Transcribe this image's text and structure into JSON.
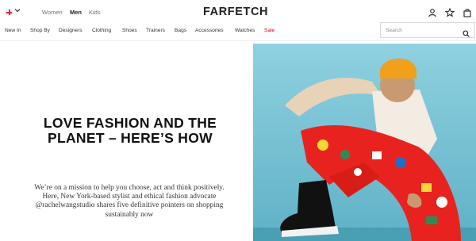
{
  "header": {
    "flag_icon": "denmark-flag-icon",
    "chevron_icon": "chevron-down-icon",
    "departments": [
      "Women",
      "Men",
      "Kids"
    ],
    "active_department": "Men",
    "logo": "FARFETCH",
    "icons": [
      "user-icon",
      "star-icon",
      "bag-icon"
    ]
  },
  "nav": {
    "items": [
      "New In",
      "Shop By",
      "Designers",
      "Clothing",
      "Shoes",
      "Trainers",
      "Bags",
      "Accessories",
      "Watches"
    ],
    "sale_label": "Sale",
    "sale_color": "#d0021b"
  },
  "search": {
    "placeholder": "Search",
    "icon": "search-icon"
  },
  "main": {
    "headline": "LOVE FASHION AND THE PLANET – HERE’S HOW",
    "body": "We’re on a mission to help you choose, act and think positively. Here, New York-based stylist and ethical fashion advocate @rachelwangstudio shares five definitive pointers on shopping sustainably now"
  },
  "hero": {
    "description_icon": "hero-photo",
    "background_color": "#7ec6d8",
    "accent_color": "#e8231f"
  }
}
